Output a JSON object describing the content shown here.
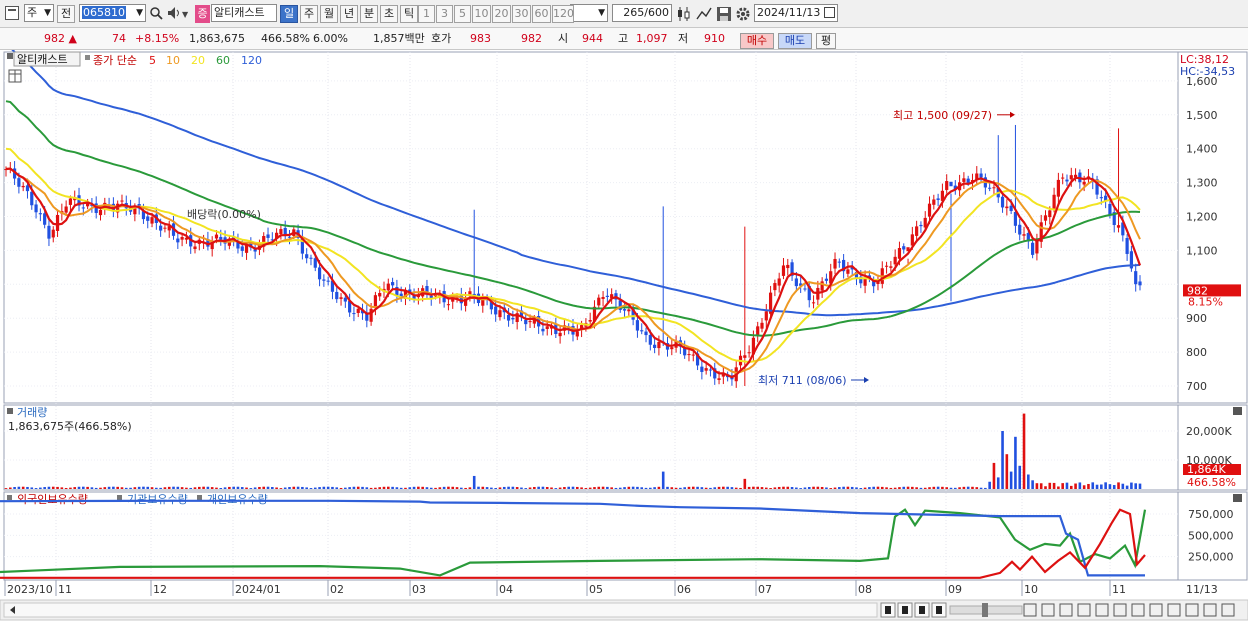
{
  "toolbar": {
    "market_select": "주",
    "prev_label": "전",
    "stock_code": "065810",
    "stock_badge": "증",
    "stock_name": "알티캐스트",
    "period_buttons": [
      "일",
      "주",
      "월",
      "년",
      "분",
      "초",
      "틱"
    ],
    "interval_buttons": [
      "1",
      "3",
      "5",
      "10",
      "20",
      "30",
      "60",
      "120"
    ],
    "count_value": "265",
    "count_total": "/600",
    "date_value": "2024/11/13"
  },
  "info": {
    "price": "982",
    "arrow": "▲",
    "change": "74",
    "change_pct": "+8.15%",
    "volume": "1,863,675",
    "volume_pct": "466.58%",
    "turnover": "6.00%",
    "amount": "1,857백만",
    "quote_label": "호가",
    "bid": "983",
    "ask": "982",
    "open_label": "시",
    "open": "944",
    "high_label": "고",
    "high": "1,097",
    "low_label": "저",
    "low": "910",
    "buy_label": "매수",
    "sell_label": "매도",
    "avg_label": "평"
  },
  "price_panel": {
    "stock_tag": "알티캐스트",
    "legend_title": "종가 단순",
    "ma_periods": [
      "5",
      "10",
      "20",
      "60",
      "120"
    ],
    "ma_colors": [
      "#dd1111",
      "#ee9922",
      "#f2e422",
      "#2a9a3a",
      "#2f5fd8"
    ],
    "lc": "LC:38,12",
    "hc": "HC:-34,53",
    "y_ticks": [
      "1,600",
      "1,500",
      "1,400",
      "1,300",
      "1,200",
      "1,100",
      "1,000",
      "900",
      "800",
      "700"
    ],
    "current_price_tag": "982",
    "current_pct_tag": "8.15%",
    "high_annotation": "최고 1,500 (09/27)",
    "low_annotation": "최저 711 (08/06)",
    "dividend_annotation": "배당락(0.00%)"
  },
  "volume_panel": {
    "title": "거래량",
    "summary": "1,863,675주(466.58%)",
    "y_ticks": [
      "20,000K",
      "10,000K"
    ],
    "current_tag": "1,864K",
    "current_pct": "466.58%"
  },
  "holdings_panel": {
    "legend": [
      "외국인보유수량",
      "기관보유수량",
      "개인보유수량"
    ],
    "colors": [
      "#dd1111",
      "#2f5fd8",
      "#2a9a3a"
    ],
    "y_ticks": [
      "750,000",
      "500,000",
      "250,000"
    ]
  },
  "x_axis": {
    "labels": [
      "2023/10",
      "11",
      "12",
      "2024/01",
      "02",
      "03",
      "04",
      "05",
      "06",
      "07",
      "08",
      "09",
      "10",
      "11"
    ],
    "right_label": "11/13"
  }
}
